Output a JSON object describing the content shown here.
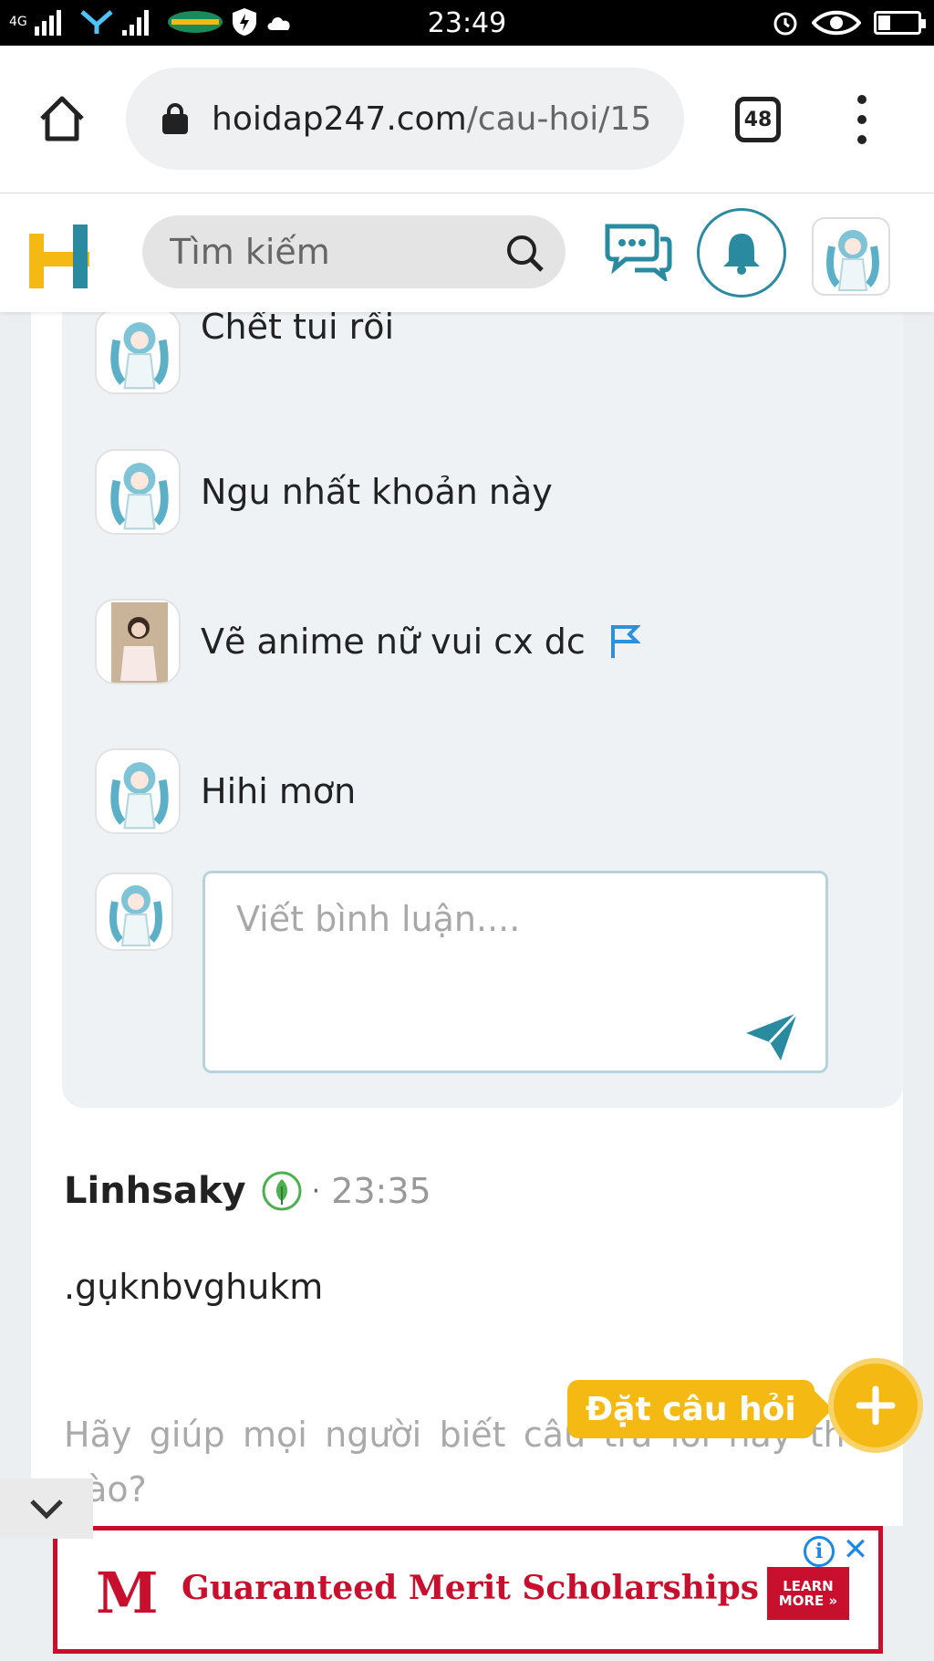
{
  "status_bar": {
    "time": "23:49",
    "network": "4G",
    "battery_level": 0.3
  },
  "browser": {
    "url_domain": "hoidap247.com",
    "url_path": "/cau-hoi/15",
    "tab_count": "48"
  },
  "site_header": {
    "search_placeholder": "Tìm kiếm",
    "brand_colors": {
      "logo_yellow": "#f4b913",
      "logo_teal": "#2a8a9f"
    }
  },
  "comments": [
    {
      "text": "Chết tui rồi",
      "avatar": "anime-avatar",
      "flag": false
    },
    {
      "text": "Ngu nhất khoản này",
      "avatar": "anime-avatar",
      "flag": false
    },
    {
      "text": "Vẽ anime nữ vui cx dc",
      "avatar": "photo-avatar",
      "flag": true
    },
    {
      "text": "Hihi mơn",
      "avatar": "anime-avatar",
      "flag": false
    }
  ],
  "compose": {
    "placeholder": "Viết bình luận...."
  },
  "answer": {
    "author": "Linhsaky",
    "separator": "·",
    "time": "23:35",
    "body": ".gụknbvghukm"
  },
  "help_prompt": "Hãy giúp mọi người biết câu trả lời này thế nào?",
  "fab": {
    "label": "Đặt câu hỏi",
    "icon": "plus-icon"
  },
  "ad": {
    "logo": "M",
    "headline": "Guaranteed Merit Scholarships",
    "cta_line1": "LEARN",
    "cta_line2": "MORE »",
    "info": "i",
    "close": "✕",
    "color": "#c8102e"
  }
}
